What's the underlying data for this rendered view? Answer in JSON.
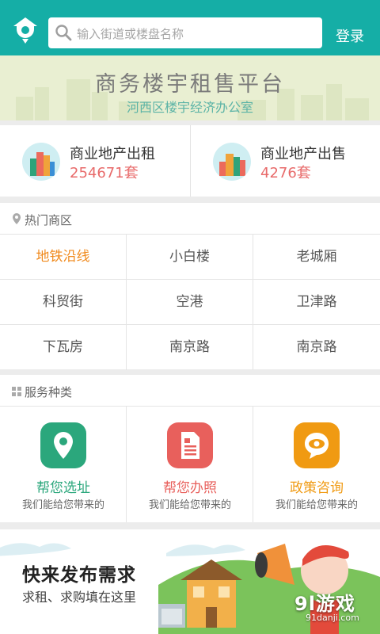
{
  "header": {
    "logo_icon": "house-pin-logo-icon",
    "search_icon": "search-icon",
    "search_placeholder": "输入街道或楼盘名称",
    "login_label": "登录",
    "accent_color": "#15aea6"
  },
  "banner": {
    "title": "商务楼宇租售平台",
    "subtitle": "河西区楼宇经济办公室"
  },
  "stats": [
    {
      "title": "商业地产出租",
      "count": "254671套",
      "icon": "buildings-icon"
    },
    {
      "title": "商业地产出售",
      "count": "4276套",
      "icon": "buildings-icon"
    }
  ],
  "hot_areas": {
    "heading": "热门商区",
    "icon": "location-pin-icon",
    "items": [
      "地铁沿线",
      "小白楼",
      "老城厢",
      "科贸街",
      "空港",
      "卫津路",
      "下瓦房",
      "南京路",
      "南京路"
    ],
    "highlight_color": "#f08a1d"
  },
  "services": {
    "heading": "服务种类",
    "icon": "grid-icon",
    "items": [
      {
        "title": "帮您选址",
        "subtitle": "我们能给您带来的",
        "icon": "map-pin-icon",
        "color": "#2ba77c"
      },
      {
        "title": "帮您办照",
        "subtitle": "我们能给您带来的",
        "icon": "document-icon",
        "color": "#e8605c"
      },
      {
        "title": "政策咨询",
        "subtitle": "我们能给您带来的",
        "icon": "eye-chat-icon",
        "color": "#f09a12"
      }
    ]
  },
  "promo": {
    "title": "快来发布需求",
    "subtitle": "求租、求购填在这里",
    "illustration": "house-megaphone-illustration"
  },
  "watermark": {
    "main": "9l游戏",
    "url": "91danji.com"
  }
}
